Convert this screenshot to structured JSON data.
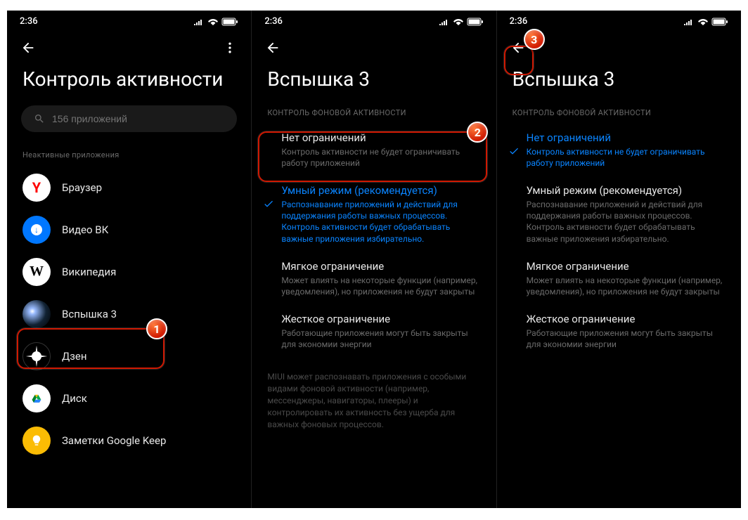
{
  "status": {
    "time": "2:36"
  },
  "screen1": {
    "title": "Контроль активности",
    "search_placeholder": "156 приложений",
    "section": "Неактивные приложения",
    "apps": [
      {
        "name": "Браузер"
      },
      {
        "name": "Видео ВК"
      },
      {
        "name": "Википедия"
      },
      {
        "name": "Вспышка 3"
      },
      {
        "name": "Дзен"
      },
      {
        "name": "Диск"
      },
      {
        "name": "Заметки Google Keep"
      }
    ]
  },
  "screen2": {
    "title": "Вспышка 3",
    "section": "КОНТРОЛЬ ФОНОВОЙ АКТИВНОСТИ",
    "options": [
      {
        "title": "Нет ограничений",
        "desc": "Контроль активности не будет ограничивать работу приложений"
      },
      {
        "title": "Умный режим (рекомендуется)",
        "desc": "Распознавание приложений и действий для поддержания работы важных процессов. Контроль активности будет обрабатывать важные приложения избирательно."
      },
      {
        "title": "Мягкое ограничение",
        "desc": "Может влиять на некоторые функции (например, уведомления), но приложения не будут закрыты"
      },
      {
        "title": "Жесткое ограничение",
        "desc": "Работающие приложения могут быть закрыты для экономии энергии"
      }
    ],
    "footer": "MIUI может распознавать приложения с особыми видами фоновой активности (например, мессенджеры, навигаторы, плееры) и контролировать их активность без ущерба для важных фоновых процессов."
  },
  "screen3": {
    "title": "Вспышка 3",
    "section": "КОНТРОЛЬ ФОНОВОЙ АКТИВНОСТИ",
    "options": [
      {
        "title": "Нет ограничений",
        "desc": "Контроль активности не будет ограничивать работу приложений"
      },
      {
        "title": "Умный режим (рекомендуется)",
        "desc": "Распознавание приложений и действий для поддержания работы важных процессов. Контроль активности будет обрабатывать важные приложения избирательно."
      },
      {
        "title": "Мягкое ограничение",
        "desc": "Может влиять на некоторые функции (например, уведомления), но приложения не будут закрыты"
      },
      {
        "title": "Жесткое ограничение",
        "desc": "Работающие приложения могут быть закрыты для экономии энергии"
      }
    ]
  },
  "markers": {
    "m1": "1",
    "m2": "2",
    "m3": "3"
  }
}
